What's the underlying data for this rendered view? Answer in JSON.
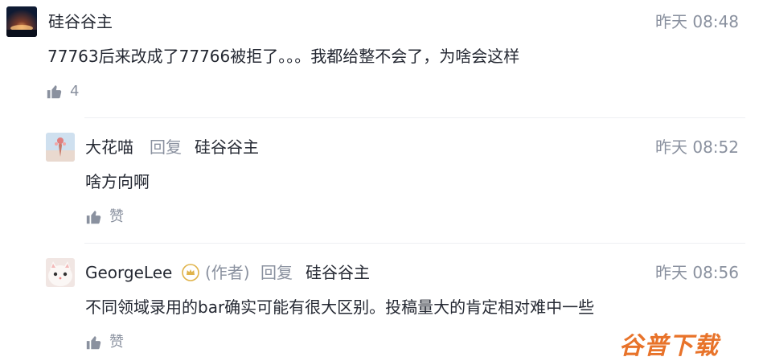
{
  "comment_main": {
    "author": "硅谷谷主",
    "time": "昨天 08:48",
    "text": "77763后来改成了77766被拒了。。。我都给整不会了，为啥会这样",
    "like_count": "4"
  },
  "reply_1": {
    "author": "大花喵",
    "reply_word": "回复",
    "reply_to": "硅谷谷主",
    "time": "昨天 08:52",
    "text": "啥方向啊",
    "like_label": "赞"
  },
  "reply_2": {
    "author": "GeorgeLee",
    "author_tag": "(作者)",
    "reply_word": "回复",
    "reply_to": "硅谷谷主",
    "time": "昨天 08:56",
    "text": "不同领域录用的bar确实可能有很大区别。投稿量大的肯定相对难中一些",
    "like_label": "赞"
  },
  "watermark": "谷普下载",
  "colors": {
    "text": "#252933",
    "muted": "#8a919f",
    "divider": "#eeeff2",
    "watermark": "#e8732a",
    "badge": "#e0b34a"
  },
  "icons": {
    "like": "thumbs-up-icon",
    "author_badge": "crown-badge-icon"
  }
}
